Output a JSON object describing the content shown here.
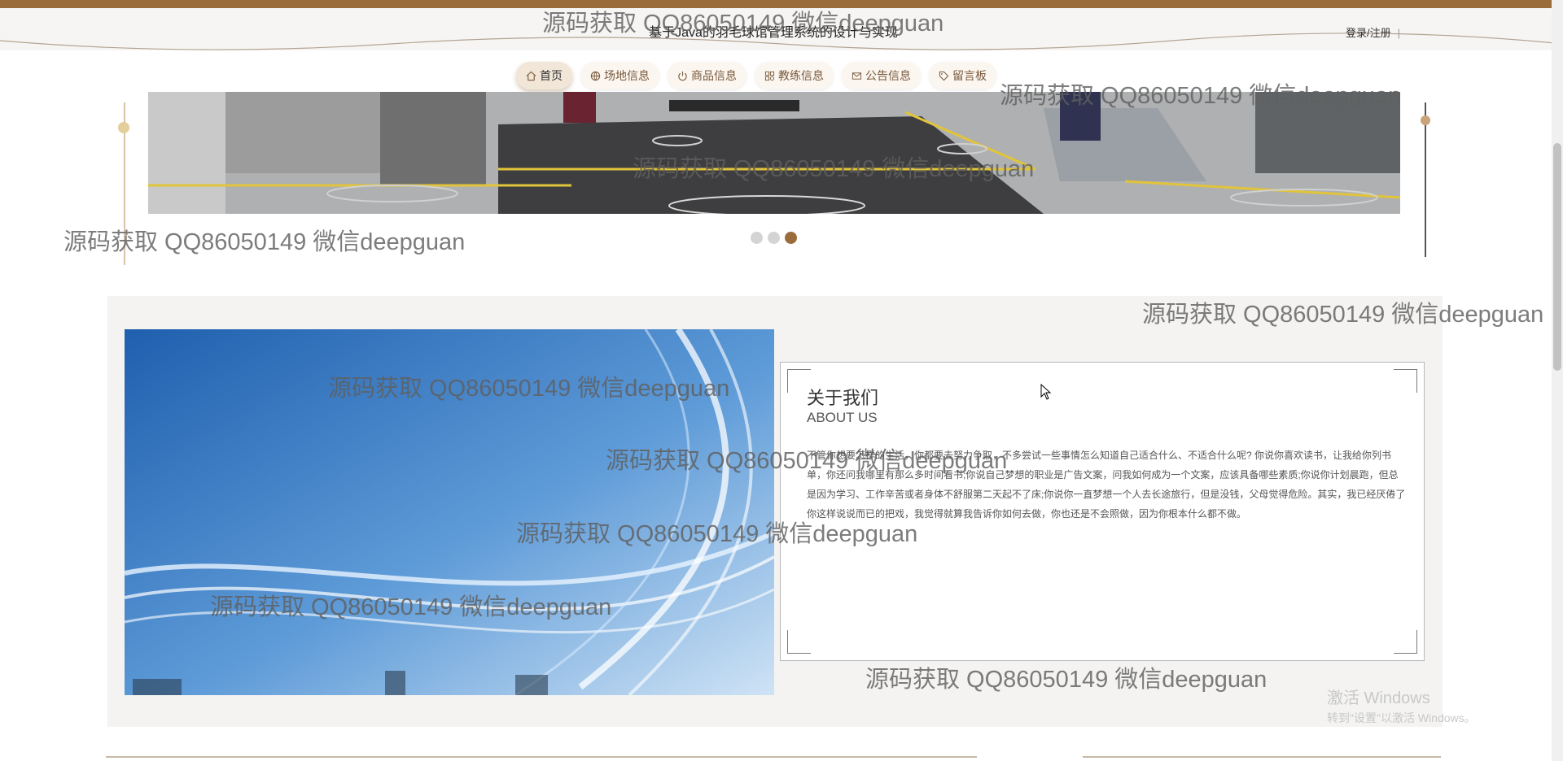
{
  "header": {
    "site_title": "基于Java的羽毛球馆管理系统的设计与实现",
    "auth_label": "登录/注册",
    "auth_sep": "|"
  },
  "nav": {
    "items": [
      {
        "label": "首页",
        "icon": "home-icon",
        "active": true
      },
      {
        "label": "场地信息",
        "icon": "globe-icon"
      },
      {
        "label": "商品信息",
        "icon": "power-icon"
      },
      {
        "label": "教练信息",
        "icon": "grid-icon"
      },
      {
        "label": "公告信息",
        "icon": "mail-icon"
      },
      {
        "label": "留言板",
        "icon": "tag-icon"
      }
    ]
  },
  "carousel": {
    "slide_count": 3,
    "active_index": 2
  },
  "about": {
    "title": "关于我们",
    "subtitle": "ABOUT US",
    "body": "不管你想要怎样的生活，你都要去努力争取，不多尝试一些事情怎么知道自己适合什么、不适合什么呢? 你说你喜欢读书，让我给你列书单，你还问我哪里有那么多时间看书;你说自己梦想的职业是广告文案，问我如何成为一个文案，应该具备哪些素质;你说你计划晨跑，但总是因为学习、工作辛苦或者身体不舒服第二天起不了床;你说你一直梦想一个人去长途旅行，但是没钱，父母觉得危险。其实，我已经厌倦了你这样说说而已的把戏，我觉得就算我告诉你如何去做，你也还是不会照做，因为你根本什么都不做。"
  },
  "watermark": {
    "text": "源码获取 QQ86050149 微信deepguan"
  },
  "os_watermark": {
    "line1": "激活 Windows",
    "line2": "转到\"设置\"以激活 Windows。"
  },
  "colors": {
    "accent": "#9a6c3a",
    "nav_text": "#7a5a3c",
    "nav_bg": "#fbf6f0"
  }
}
